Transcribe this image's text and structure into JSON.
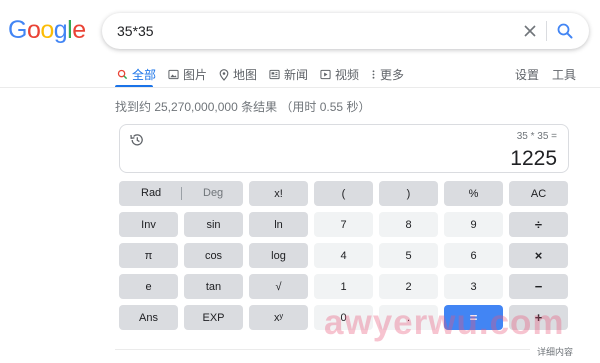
{
  "logo": {
    "letters": [
      "G",
      "o",
      "o",
      "g",
      "l",
      "e"
    ]
  },
  "search": {
    "query": "35*35"
  },
  "tabs": [
    {
      "label": "全部",
      "icon": "search-icon",
      "active": true
    },
    {
      "label": "图片",
      "icon": "image-icon",
      "active": false
    },
    {
      "label": "地图",
      "icon": "map-pin-icon",
      "active": false
    },
    {
      "label": "新闻",
      "icon": "news-icon",
      "active": false
    },
    {
      "label": "视频",
      "icon": "play-icon",
      "active": false
    },
    {
      "label": "更多",
      "icon": "more-vert-icon",
      "active": false
    }
  ],
  "tools": {
    "settings": "设置",
    "tools": "工具"
  },
  "result_stats": "找到约 25,270,000,000 条结果 （用时 0.55 秒）",
  "calculator": {
    "expression": "35 * 35 =",
    "result": "1225",
    "rad": "Rad",
    "deg": "Deg",
    "rows": [
      [
        "x!",
        "(",
        ")",
        "%",
        "AC"
      ],
      [
        "Inv",
        "sin",
        "ln",
        "7",
        "8",
        "9",
        "÷"
      ],
      [
        "π",
        "cos",
        "log",
        "4",
        "5",
        "6",
        "×"
      ],
      [
        "e",
        "tan",
        "√",
        "1",
        "2",
        "3",
        "−"
      ],
      [
        "Ans",
        "EXP",
        "xʸ",
        "0",
        ".",
        "=",
        "+"
      ]
    ]
  },
  "watermark": "awyerwu.com",
  "details_link": "详细内容",
  "colors": {
    "accent": "#1a73e8",
    "equals_key": "#4285f4",
    "func_key": "#dadce0",
    "num_key": "#f1f3f4"
  }
}
